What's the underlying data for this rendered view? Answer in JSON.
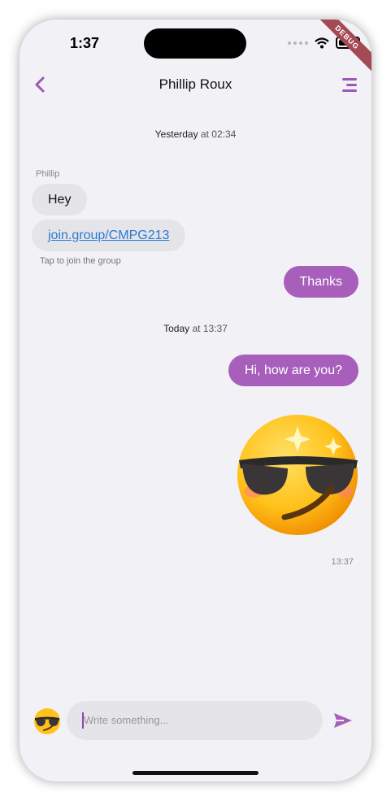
{
  "status_bar": {
    "time": "1:37",
    "debug_label": "DEBUG"
  },
  "header": {
    "title": "Phillip Roux"
  },
  "messages": {
    "stamp1_day": "Yesterday",
    "stamp1_at": "at 02:34",
    "sender_name": "Phillip",
    "msg1": "Hey",
    "msg2_link": "join.group/CMPG213",
    "msg2_hint": "Tap to join the group",
    "msg3": "Thanks",
    "stamp2_day": "Today",
    "stamp2_at": "at 13:37",
    "msg4": "Hi, how are you?",
    "msg5_time": "13:37"
  },
  "input": {
    "placeholder": "Write something..."
  },
  "colors": {
    "accent": "#a75fbb",
    "incoming_bubble": "#e5e4e9",
    "link": "#2a7ad6"
  },
  "icons": {
    "back": "chevron-left-icon",
    "menu": "menu-icon",
    "send": "send-icon",
    "emoji": "sunglasses-emoji-icon"
  }
}
